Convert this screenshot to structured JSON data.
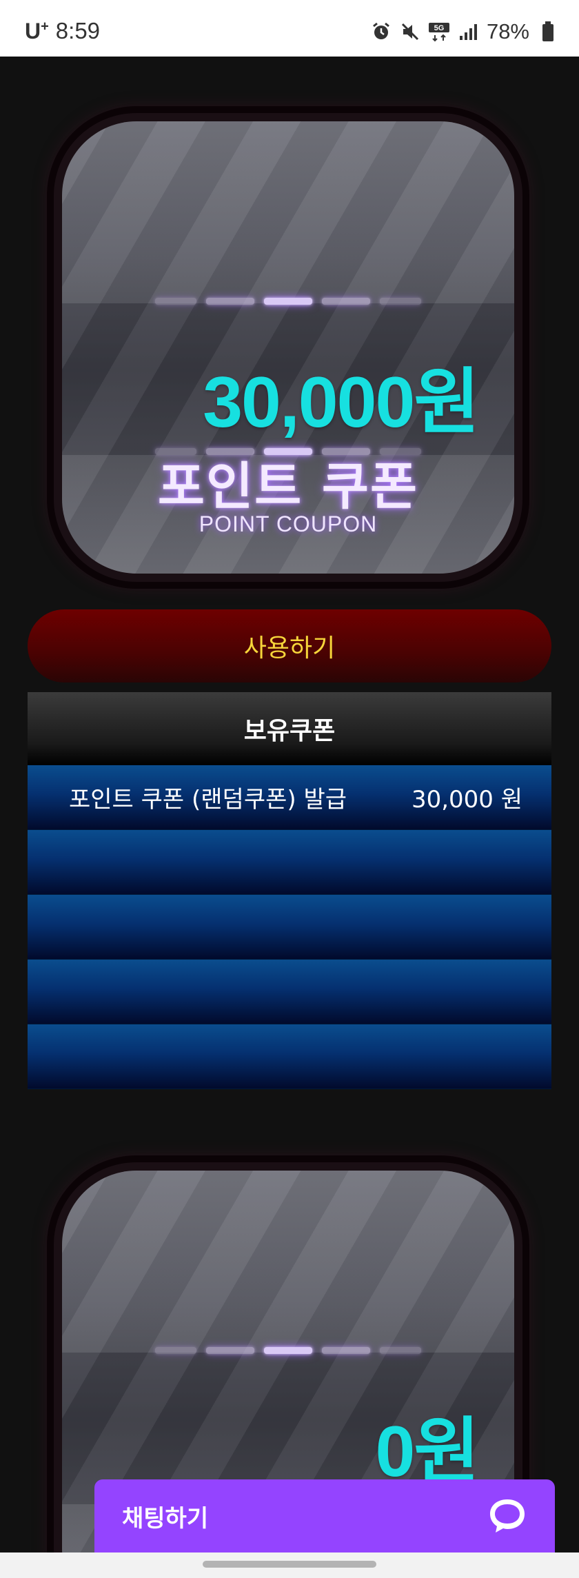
{
  "status_bar": {
    "carrier": "U",
    "carrier_sup": "+",
    "time": "8:59",
    "network": "5G",
    "battery": "78%",
    "icons": [
      "alarm-icon",
      "mute-icon",
      "5g-icon",
      "signal-icon",
      "battery-icon"
    ]
  },
  "coupons": [
    {
      "amount": "30,000원",
      "title": "포인트 쿠폰",
      "subtitle": "POINT COUPON"
    },
    {
      "amount": "0원"
    }
  ],
  "use_button": {
    "label": "사용하기"
  },
  "held_coupons": {
    "header": "보유쿠폰",
    "rows": [
      {
        "name": "포인트 쿠폰 (랜덤쿠폰) 발급",
        "amount": "30,000 원"
      },
      {
        "name": "",
        "amount": ""
      },
      {
        "name": "",
        "amount": ""
      },
      {
        "name": "",
        "amount": ""
      },
      {
        "name": "",
        "amount": ""
      }
    ]
  },
  "chat": {
    "label": "채팅하기",
    "icon": "chat-bubble-icon"
  },
  "colors": {
    "amount": "#17e0e0",
    "use_button_text": "#f6d53a",
    "chat_background": "#9444ff"
  }
}
